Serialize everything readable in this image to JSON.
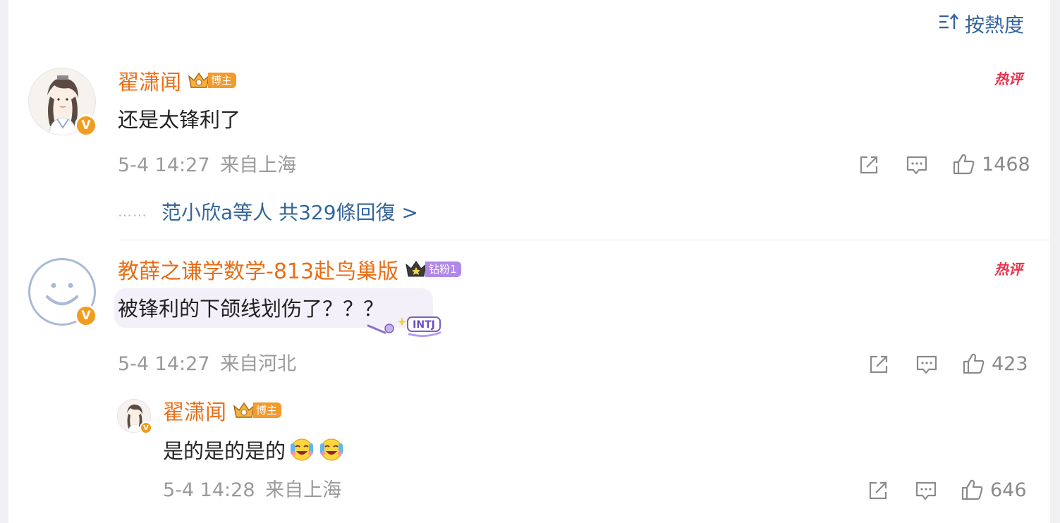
{
  "sort": {
    "label": "按熱度",
    "icon": "sort-icon"
  },
  "comments": [
    {
      "username": "翟潇闻",
      "badge": "博主",
      "hot_tag": "热评",
      "text": "还是太锋利了",
      "time": "5-4 14:27",
      "location": "来自上海",
      "likes": "1468",
      "replies_summary": {
        "dots": "……",
        "names": "范小欣a等人",
        "count_label": "共329條回復 >"
      }
    },
    {
      "username": "教薛之谦学数学-813赴鸟巢版",
      "badge": "钻粉1",
      "hot_tag": "热评",
      "text": "被锋利的下颌线划伤了？？？",
      "sticker": "INTJ",
      "time": "5-4 14:27",
      "location": "来自河北",
      "likes": "423",
      "reply": {
        "username": "翟潇闻",
        "badge": "博主",
        "text": "是的是的是的",
        "time": "5-4 14:28",
        "location": "来自上海",
        "likes": "646"
      }
    }
  ],
  "colors": {
    "username": "#e86e16",
    "link": "#33659b",
    "meta": "#9a9a9a",
    "hot": "#e8324a",
    "verified": "#f29c1f"
  }
}
